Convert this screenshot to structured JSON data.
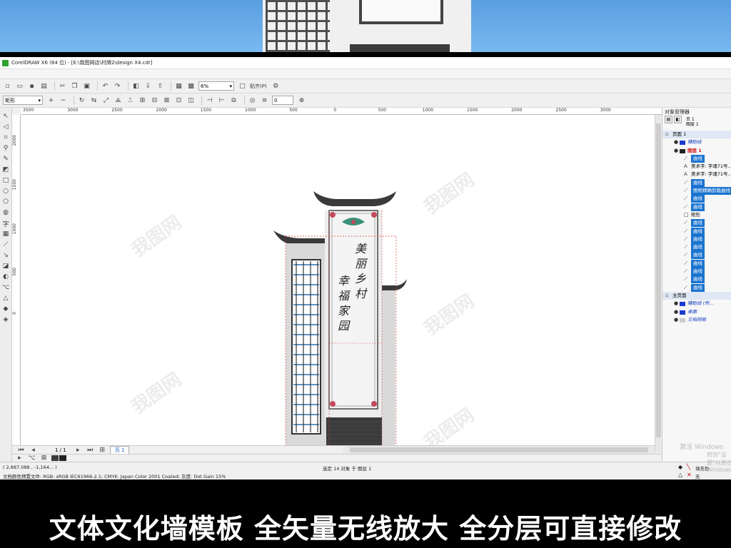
{
  "window": {
    "title": "CorelDRAW X6 (64 位) - [E:\\我图网店\\村牌2\\design X4.cdr]"
  },
  "toolbar": {
    "zoom": "6%",
    "snap_label": "贴齐(P)",
    "shape_dropdown": "矩形",
    "angle_value": "0"
  },
  "rulers": {
    "horizontal": [
      "3500",
      "3000",
      "2500",
      "2000",
      "1500",
      "1000",
      "500",
      "0",
      "500",
      "1000",
      "1500",
      "2000",
      "2500",
      "3000"
    ],
    "vertical": [
      "2000",
      "1500",
      "1000",
      "500",
      "0"
    ]
  },
  "artwork": {
    "sign_text_right": "美丽乡村",
    "sign_text_left": "幸福家园"
  },
  "page_nav": {
    "count": "1 / 1",
    "tab": "页 1"
  },
  "status": {
    "coordinates": "( 2,887.088 , -1,164... )",
    "profile": "文档颜色预置文件: RGB: sRGB IEC61966-2.1; CMYK: Japan Color 2001 Coated; 灰度: Dot Gain 15%",
    "selection": "选定 14 对象 于 图层 1",
    "fill": "填充色",
    "outline": "无"
  },
  "docker": {
    "title": "对象管理器",
    "page_info": [
      "页 1",
      "图层 1"
    ],
    "tree": [
      {
        "label": "页面 1",
        "type": "page"
      },
      {
        "label": "辅助线",
        "type": "layer-guides"
      },
      {
        "label": "图层 1",
        "type": "layer-active"
      },
      {
        "label": "曲线",
        "type": "curve",
        "selected": true
      },
      {
        "label": "美术字: 字魂71号...",
        "type": "text"
      },
      {
        "label": "美术字: 字魂71号...",
        "type": "text"
      },
      {
        "label": "曲线",
        "type": "curve",
        "selected": true
      },
      {
        "label": "图框精确剪裁曲线",
        "type": "curve",
        "selected": true
      },
      {
        "label": "曲线",
        "type": "curve",
        "selected": true
      },
      {
        "label": "曲线",
        "type": "curve",
        "selected": true
      },
      {
        "label": "矩形",
        "type": "rect"
      },
      {
        "label": "曲线",
        "type": "curve",
        "selected": true
      },
      {
        "label": "曲线",
        "type": "curve",
        "selected": true
      },
      {
        "label": "曲线",
        "type": "curve",
        "selected": true
      },
      {
        "label": "曲线",
        "type": "curve",
        "selected": true
      },
      {
        "label": "曲线",
        "type": "curve",
        "selected": true
      },
      {
        "label": "曲线",
        "type": "curve",
        "selected": true
      },
      {
        "label": "曲线",
        "type": "curve",
        "selected": true
      },
      {
        "label": "曲线",
        "type": "curve",
        "selected": true
      },
      {
        "label": "曲线",
        "type": "curve",
        "selected": true
      },
      {
        "label": "主页面",
        "type": "page"
      },
      {
        "label": "辅助线 (所...",
        "type": "master-guides"
      },
      {
        "label": "桌面",
        "type": "master-desktop"
      },
      {
        "label": "文档网格",
        "type": "master-grid"
      }
    ]
  },
  "system": {
    "watermark_line1": "激活 Windows",
    "watermark_line2": "转到\"设置\"以激活 Windows"
  },
  "caption": "文体文化墙模板  全矢量无线放大 全分层可直接修改",
  "watermark": "我图网",
  "colors": {
    "accent": "#1a73d0",
    "banner_sky": "#6aaeec",
    "brick": "#3b3b3b"
  }
}
